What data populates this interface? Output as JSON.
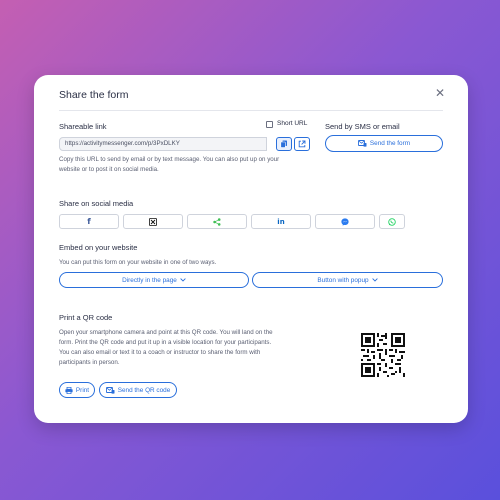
{
  "modal": {
    "title": "Share the form"
  },
  "shareable_link": {
    "heading": "Shareable link",
    "short_url_label": "Short URL",
    "url_value": "https://activitymessenger.com/p/3PxDLKY",
    "help_text_line1": "Copy this URL to send by email or by text message. You can also put up on your",
    "help_text_line2": "website or to post it on social media."
  },
  "sms_email": {
    "heading": "Send by SMS or email",
    "button_label": "Send the form"
  },
  "social": {
    "heading": "Share on social media",
    "items": [
      {
        "name": "facebook",
        "icon": "f",
        "color": "#3b5998"
      },
      {
        "name": "x",
        "icon": "𝕏",
        "color": "#111111"
      },
      {
        "name": "share",
        "icon": "share",
        "color": "#3fbf55"
      },
      {
        "name": "linkedin",
        "icon": "in",
        "color": "#0a66c2"
      },
      {
        "name": "messenger",
        "icon": "messenger",
        "color": "#2a7bf0"
      },
      {
        "name": "whatsapp",
        "icon": "whatsapp",
        "color": "#25d366"
      }
    ]
  },
  "embed": {
    "heading": "Embed on your website",
    "description": "You can put this form on your website in one of two ways.",
    "option1": "Directly in the page",
    "option2": "Button with popup"
  },
  "qr": {
    "heading": "Print a QR code",
    "text_line1": "Open your smartphone camera and point at this QR code. You will land on the",
    "text_line2": "form. Print the QR code and put it up in a visible location for your participants.",
    "text_line3": "You can also email or text it to a coach or instructor to share the form with",
    "text_line4": "participants in person.",
    "print_label": "Print",
    "send_label": "Send the QR code"
  },
  "colors": {
    "accent": "#2a6fdb",
    "text": "#2a2f45",
    "muted": "#5b6073"
  }
}
